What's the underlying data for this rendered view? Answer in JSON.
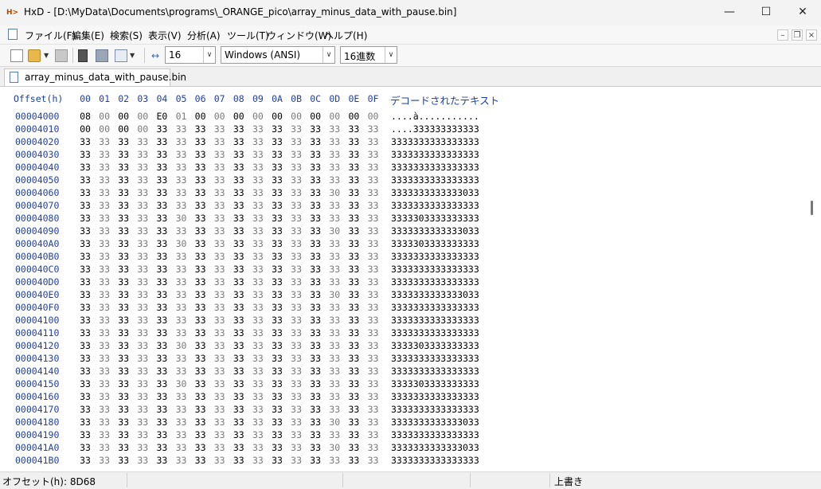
{
  "window": {
    "icon": "hex-editor-icon",
    "title": "HxD - [D:\\MyData\\Documents\\programs\\_ORANGE_pico\\array_minus_data_with_pause.bin]",
    "controls": [
      "—",
      "☐",
      "✕"
    ]
  },
  "menu": {
    "items": [
      "ファイル(F)",
      "編集(E)",
      "検索(S)",
      "表示(V)",
      "分析(A)",
      "ツール(T)",
      "ウィンドウ(W)",
      "ヘルプ(H)"
    ],
    "mdi_controls": [
      "–",
      "❐",
      "×"
    ]
  },
  "toolbar": {
    "bytes_per_row": "16",
    "charset": "Windows (ANSI)",
    "offset_base": "16進数"
  },
  "tab": {
    "label": "array_minus_data_with_pause.bin"
  },
  "editor": {
    "offset_header": "Offset(h)",
    "column_headers": [
      "00",
      "01",
      "02",
      "03",
      "04",
      "05",
      "06",
      "07",
      "08",
      "09",
      "0A",
      "0B",
      "0C",
      "0D",
      "0E",
      "0F"
    ],
    "decoded_header": "デコードされたテキスト",
    "rows": [
      {
        "offset": "00004000",
        "bytes": [
          "08",
          "00",
          "00",
          "00",
          "E0",
          "01",
          "00",
          "00",
          "00",
          "00",
          "00",
          "00",
          "00",
          "00",
          "00",
          "00"
        ],
        "text": "....à..........."
      },
      {
        "offset": "00004010",
        "bytes": [
          "00",
          "00",
          "00",
          "00",
          "33",
          "33",
          "33",
          "33",
          "33",
          "33",
          "33",
          "33",
          "33",
          "33",
          "33",
          "33"
        ],
        "text": "....333333333333"
      },
      {
        "offset": "00004020",
        "bytes": [
          "33",
          "33",
          "33",
          "33",
          "33",
          "33",
          "33",
          "33",
          "33",
          "33",
          "33",
          "33",
          "33",
          "33",
          "33",
          "33"
        ],
        "text": "3333333333333333"
      },
      {
        "offset": "00004030",
        "bytes": [
          "33",
          "33",
          "33",
          "33",
          "33",
          "33",
          "33",
          "33",
          "33",
          "33",
          "33",
          "33",
          "33",
          "33",
          "33",
          "33"
        ],
        "text": "3333333333333333"
      },
      {
        "offset": "00004040",
        "bytes": [
          "33",
          "33",
          "33",
          "33",
          "33",
          "33",
          "33",
          "33",
          "33",
          "33",
          "33",
          "33",
          "33",
          "33",
          "33",
          "33"
        ],
        "text": "3333333333333333"
      },
      {
        "offset": "00004050",
        "bytes": [
          "33",
          "33",
          "33",
          "33",
          "33",
          "33",
          "33",
          "33",
          "33",
          "33",
          "33",
          "33",
          "33",
          "33",
          "33",
          "33"
        ],
        "text": "3333333333333333"
      },
      {
        "offset": "00004060",
        "bytes": [
          "33",
          "33",
          "33",
          "33",
          "33",
          "33",
          "33",
          "33",
          "33",
          "33",
          "33",
          "33",
          "33",
          "30",
          "33",
          "33"
        ],
        "text": "3333333333333033"
      },
      {
        "offset": "00004070",
        "bytes": [
          "33",
          "33",
          "33",
          "33",
          "33",
          "33",
          "33",
          "33",
          "33",
          "33",
          "33",
          "33",
          "33",
          "33",
          "33",
          "33"
        ],
        "text": "3333333333333333"
      },
      {
        "offset": "00004080",
        "bytes": [
          "33",
          "33",
          "33",
          "33",
          "33",
          "30",
          "33",
          "33",
          "33",
          "33",
          "33",
          "33",
          "33",
          "33",
          "33",
          "33"
        ],
        "text": "3333303333333333"
      },
      {
        "offset": "00004090",
        "bytes": [
          "33",
          "33",
          "33",
          "33",
          "33",
          "33",
          "33",
          "33",
          "33",
          "33",
          "33",
          "33",
          "33",
          "30",
          "33",
          "33"
        ],
        "text": "3333333333333033"
      },
      {
        "offset": "000040A0",
        "bytes": [
          "33",
          "33",
          "33",
          "33",
          "33",
          "30",
          "33",
          "33",
          "33",
          "33",
          "33",
          "33",
          "33",
          "33",
          "33",
          "33"
        ],
        "text": "3333303333333333"
      },
      {
        "offset": "000040B0",
        "bytes": [
          "33",
          "33",
          "33",
          "33",
          "33",
          "33",
          "33",
          "33",
          "33",
          "33",
          "33",
          "33",
          "33",
          "33",
          "33",
          "33"
        ],
        "text": "3333333333333333"
      },
      {
        "offset": "000040C0",
        "bytes": [
          "33",
          "33",
          "33",
          "33",
          "33",
          "33",
          "33",
          "33",
          "33",
          "33",
          "33",
          "33",
          "33",
          "33",
          "33",
          "33"
        ],
        "text": "3333333333333333"
      },
      {
        "offset": "000040D0",
        "bytes": [
          "33",
          "33",
          "33",
          "33",
          "33",
          "33",
          "33",
          "33",
          "33",
          "33",
          "33",
          "33",
          "33",
          "33",
          "33",
          "33"
        ],
        "text": "3333333333333333"
      },
      {
        "offset": "000040E0",
        "bytes": [
          "33",
          "33",
          "33",
          "33",
          "33",
          "33",
          "33",
          "33",
          "33",
          "33",
          "33",
          "33",
          "33",
          "30",
          "33",
          "33"
        ],
        "text": "3333333333333033"
      },
      {
        "offset": "000040F0",
        "bytes": [
          "33",
          "33",
          "33",
          "33",
          "33",
          "33",
          "33",
          "33",
          "33",
          "33",
          "33",
          "33",
          "33",
          "33",
          "33",
          "33"
        ],
        "text": "3333333333333333"
      },
      {
        "offset": "00004100",
        "bytes": [
          "33",
          "33",
          "33",
          "33",
          "33",
          "33",
          "33",
          "33",
          "33",
          "33",
          "33",
          "33",
          "33",
          "33",
          "33",
          "33"
        ],
        "text": "3333333333333333"
      },
      {
        "offset": "00004110",
        "bytes": [
          "33",
          "33",
          "33",
          "33",
          "33",
          "33",
          "33",
          "33",
          "33",
          "33",
          "33",
          "33",
          "33",
          "33",
          "33",
          "33"
        ],
        "text": "3333333333333333"
      },
      {
        "offset": "00004120",
        "bytes": [
          "33",
          "33",
          "33",
          "33",
          "33",
          "30",
          "33",
          "33",
          "33",
          "33",
          "33",
          "33",
          "33",
          "33",
          "33",
          "33"
        ],
        "text": "3333303333333333"
      },
      {
        "offset": "00004130",
        "bytes": [
          "33",
          "33",
          "33",
          "33",
          "33",
          "33",
          "33",
          "33",
          "33",
          "33",
          "33",
          "33",
          "33",
          "33",
          "33",
          "33"
        ],
        "text": "3333333333333333"
      },
      {
        "offset": "00004140",
        "bytes": [
          "33",
          "33",
          "33",
          "33",
          "33",
          "33",
          "33",
          "33",
          "33",
          "33",
          "33",
          "33",
          "33",
          "33",
          "33",
          "33"
        ],
        "text": "3333333333333333"
      },
      {
        "offset": "00004150",
        "bytes": [
          "33",
          "33",
          "33",
          "33",
          "33",
          "30",
          "33",
          "33",
          "33",
          "33",
          "33",
          "33",
          "33",
          "33",
          "33",
          "33"
        ],
        "text": "3333303333333333"
      },
      {
        "offset": "00004160",
        "bytes": [
          "33",
          "33",
          "33",
          "33",
          "33",
          "33",
          "33",
          "33",
          "33",
          "33",
          "33",
          "33",
          "33",
          "33",
          "33",
          "33"
        ],
        "text": "3333333333333333"
      },
      {
        "offset": "00004170",
        "bytes": [
          "33",
          "33",
          "33",
          "33",
          "33",
          "33",
          "33",
          "33",
          "33",
          "33",
          "33",
          "33",
          "33",
          "33",
          "33",
          "33"
        ],
        "text": "3333333333333333"
      },
      {
        "offset": "00004180",
        "bytes": [
          "33",
          "33",
          "33",
          "33",
          "33",
          "33",
          "33",
          "33",
          "33",
          "33",
          "33",
          "33",
          "33",
          "30",
          "33",
          "33"
        ],
        "text": "3333333333333033"
      },
      {
        "offset": "00004190",
        "bytes": [
          "33",
          "33",
          "33",
          "33",
          "33",
          "33",
          "33",
          "33",
          "33",
          "33",
          "33",
          "33",
          "33",
          "33",
          "33",
          "33"
        ],
        "text": "3333333333333333"
      },
      {
        "offset": "000041A0",
        "bytes": [
          "33",
          "33",
          "33",
          "33",
          "33",
          "33",
          "33",
          "33",
          "33",
          "33",
          "33",
          "33",
          "33",
          "30",
          "33",
          "33"
        ],
        "text": "3333333333333033"
      },
      {
        "offset": "000041B0",
        "bytes": [
          "33",
          "33",
          "33",
          "33",
          "33",
          "33",
          "33",
          "33",
          "33",
          "33",
          "33",
          "33",
          "33",
          "33",
          "33",
          "33"
        ],
        "text": "3333333333333333"
      }
    ]
  },
  "statusbar": {
    "offset": "オフセット(h): 8D68",
    "mode": "上書き"
  },
  "colors": {
    "offset_blue": "#1f3fa8",
    "odd_byte_gray": "#7a7a7a",
    "even_byte_black": "#000000"
  }
}
